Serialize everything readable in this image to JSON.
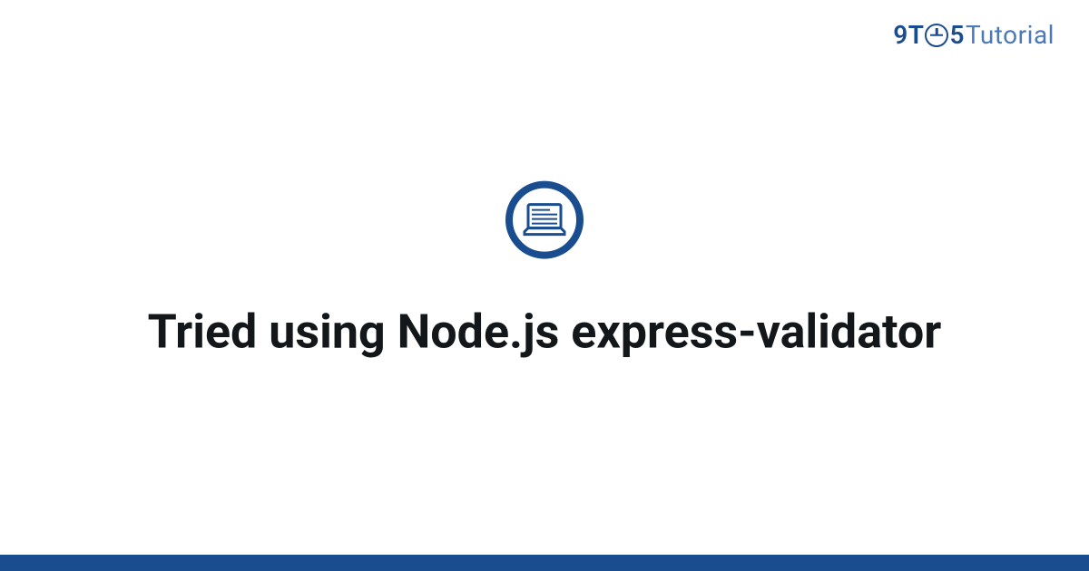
{
  "logo": {
    "nine": "9",
    "t": "T",
    "five": "5",
    "tutorial": "Tutorial"
  },
  "icon": {
    "name": "laptop-icon"
  },
  "title": "Tried using Node.js express-validator",
  "colors": {
    "brand": "#1a4d8f",
    "brandLight": "#4a7bb8",
    "text": "#14171a"
  }
}
